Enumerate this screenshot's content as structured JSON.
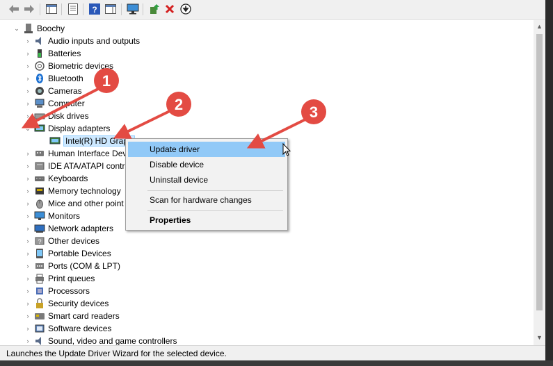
{
  "toolbar": {
    "buttons": [
      "back-icon",
      "forward-icon",
      "show-hide-console-tree-icon",
      "properties-icon",
      "help-icon",
      "action-pane-icon",
      "monitor-icon",
      "update-driver-icon",
      "uninstall-icon",
      "download-icon"
    ]
  },
  "tree": {
    "root": "Boochy",
    "categories": [
      "Audio inputs and outputs",
      "Batteries",
      "Biometric devices",
      "Bluetooth",
      "Cameras",
      "Computer",
      "Disk drives",
      "Display adapters",
      "Human Interface Dev",
      "IDE ATA/ATAPI contro",
      "Keyboards",
      "Memory technology",
      "Mice and other point",
      "Monitors",
      "Network adapters",
      "Other devices",
      "Portable Devices",
      "Ports (COM & LPT)",
      "Print queues",
      "Processors",
      "Security devices",
      "Smart card readers",
      "Software devices",
      "Sound, video and game controllers"
    ],
    "child": "Intel(R) HD Graph"
  },
  "context_menu": {
    "update_driver": "Update driver",
    "disable_device": "Disable device",
    "uninstall_device": "Uninstall device",
    "scan": "Scan for hardware changes",
    "properties": "Properties"
  },
  "callouts": [
    "1",
    "2",
    "3"
  ],
  "status_bar": "Launches the Update Driver Wizard for the selected device.",
  "colors": {
    "arrow": "#e34b43",
    "highlight": "#91c9f7",
    "selection": "#cce8ff"
  }
}
